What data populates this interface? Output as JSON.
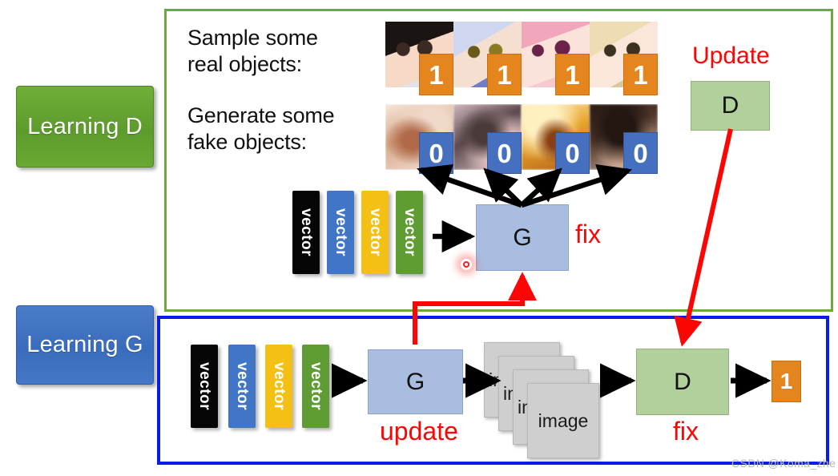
{
  "left_labels": {
    "learning_d": "Learning\nD",
    "learning_g": "Learning\nG"
  },
  "panel_d": {
    "headline_real": "Sample some\nreal objects:",
    "headline_fake": "Generate some\nfake objects:",
    "real_labels": [
      "1",
      "1",
      "1",
      "1"
    ],
    "fake_labels": [
      "0",
      "0",
      "0",
      "0"
    ],
    "generator_label": "G",
    "generator_note": "fix",
    "discriminator_label": "D",
    "discriminator_note": "Update",
    "vectors": [
      "vector",
      "vector",
      "vector",
      "vector"
    ]
  },
  "panel_g": {
    "vectors": [
      "vector",
      "vector",
      "vector",
      "vector"
    ],
    "generator_label": "G",
    "generator_note": "update",
    "image_stack": [
      "image",
      "image",
      "image",
      "image"
    ],
    "discriminator_label": "D",
    "discriminator_note": "fix",
    "output_label": "1"
  },
  "watermark": "CSDN @Koma_zhe",
  "colors": {
    "panel_d_border": "#6aaa3c",
    "panel_g_border": "#0a1ae8",
    "learning_d_fill": "#5d9c2c",
    "learning_g_fill": "#3a6cbd",
    "generator_fill": "#a8bddf",
    "discriminator_fill": "#b2d09c",
    "real_chip": "#e5851d",
    "fake_chip": "#4570c0",
    "annotation_red": "#fb0505",
    "arrow_black": "#000000"
  }
}
